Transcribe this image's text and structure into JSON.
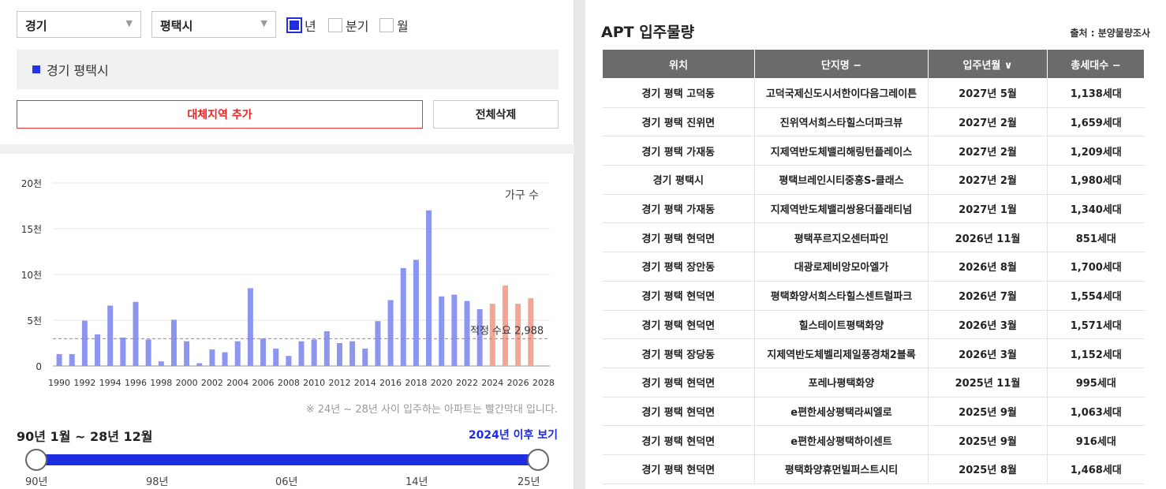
{
  "filters": {
    "province": "경기",
    "city": "평택시",
    "periods": [
      {
        "label": "년",
        "checked": true
      },
      {
        "label": "분기",
        "checked": false
      },
      {
        "label": "월",
        "checked": false
      }
    ]
  },
  "region_tag": "경기 평택시",
  "buttons": {
    "add_region": "대체지역 추가",
    "delete_all": "전체삭제"
  },
  "chart_data": {
    "type": "bar",
    "series_label": "가구 수",
    "y_ticks": [
      "0",
      "5천",
      "10천",
      "15천",
      "20천"
    ],
    "ylim": [
      0,
      20000
    ],
    "x_tick_labels": [
      "1990",
      "1992",
      "1994",
      "1996",
      "1998",
      "2000",
      "2002",
      "2004",
      "2006",
      "2008",
      "2010",
      "2012",
      "2014",
      "2016",
      "2018",
      "2020",
      "2022",
      "2024",
      "2026",
      "2028"
    ],
    "categories": [
      1990,
      1991,
      1992,
      1993,
      1994,
      1995,
      1996,
      1997,
      1998,
      1999,
      2000,
      2001,
      2002,
      2003,
      2004,
      2005,
      2006,
      2007,
      2008,
      2009,
      2010,
      2011,
      2012,
      2013,
      2014,
      2015,
      2016,
      2017,
      2018,
      2019,
      2020,
      2021,
      2022,
      2023,
      2024,
      2025,
      2026,
      2027,
      2028
    ],
    "values": [
      1300,
      1300,
      4950,
      3450,
      6600,
      3100,
      7000,
      2900,
      500,
      5050,
      2700,
      300,
      1800,
      1500,
      2700,
      8500,
      3000,
      1900,
      1100,
      2700,
      2900,
      3800,
      2500,
      2700,
      1900,
      4900,
      7200,
      10700,
      11600,
      17000,
      7600,
      7800,
      7100,
      6200,
      6800,
      8800,
      6800,
      7400,
      0
    ],
    "projection_from": 2024,
    "colors": {
      "past": "#8c96f0",
      "future": "#f5a594"
    },
    "reference_line": {
      "label": "적정 수요",
      "value": 2988,
      "value_text": "2,988",
      "color": "#ee6666"
    },
    "grid": true
  },
  "chart_note": "※ 24년 ~ 28년 사이 입주하는 아파트는 빨간막대 입니다.",
  "range": {
    "title": "90년 1월 ~ 28년 12월",
    "link": "2024년 이후 보기",
    "labels": [
      "90년",
      "98년",
      "06년",
      "14년",
      "25년"
    ]
  },
  "table": {
    "title": "APT 입주물량",
    "source": "출처 : 분양물량조사",
    "headers": [
      "위치",
      "단지명 −",
      "입주년월 ∨",
      "총세대수 −"
    ],
    "rows": [
      [
        "경기 평택 고덕동",
        "고덕국제신도시서한이다음그레이튼",
        "2027년 5월",
        "1,138세대"
      ],
      [
        "경기 평택 진위면",
        "진위역서희스타힐스더파크뷰",
        "2027년 2월",
        "1,659세대"
      ],
      [
        "경기 평택 가재동",
        "지제역반도체밸리해링턴플레이스",
        "2027년 2월",
        "1,209세대"
      ],
      [
        "경기 평택시",
        "평택브레인시티중흥S-클래스",
        "2027년 2월",
        "1,980세대"
      ],
      [
        "경기 평택 가재동",
        "지제역반도체밸리쌍용더플래티넘",
        "2027년 1월",
        "1,340세대"
      ],
      [
        "경기 평택 현덕면",
        "평택푸르지오센터파인",
        "2026년 11월",
        "851세대"
      ],
      [
        "경기 평택 장안동",
        "대광로제비앙모아엘가",
        "2026년 8월",
        "1,700세대"
      ],
      [
        "경기 평택 현덕면",
        "평택화양서희스타힐스센트럴파크",
        "2026년 7월",
        "1,554세대"
      ],
      [
        "경기 평택 현덕면",
        "힐스테이트평택화양",
        "2026년 3월",
        "1,571세대"
      ],
      [
        "경기 평택 장당동",
        "지제역반도체벨리제일풍경채2블록",
        "2026년 3월",
        "1,152세대"
      ],
      [
        "경기 평택 현덕면",
        "포레나평택화양",
        "2025년 11월",
        "995세대"
      ],
      [
        "경기 평택 현덕면",
        "e편한세상평택라씨엘로",
        "2025년 9월",
        "1,063세대"
      ],
      [
        "경기 평택 현덕면",
        "e편한세상평택하이센트",
        "2025년 9월",
        "916세대"
      ],
      [
        "경기 평택 현덕면",
        "평택화양휴먼빌퍼스트시티",
        "2025년 8월",
        "1,468세대"
      ]
    ]
  }
}
